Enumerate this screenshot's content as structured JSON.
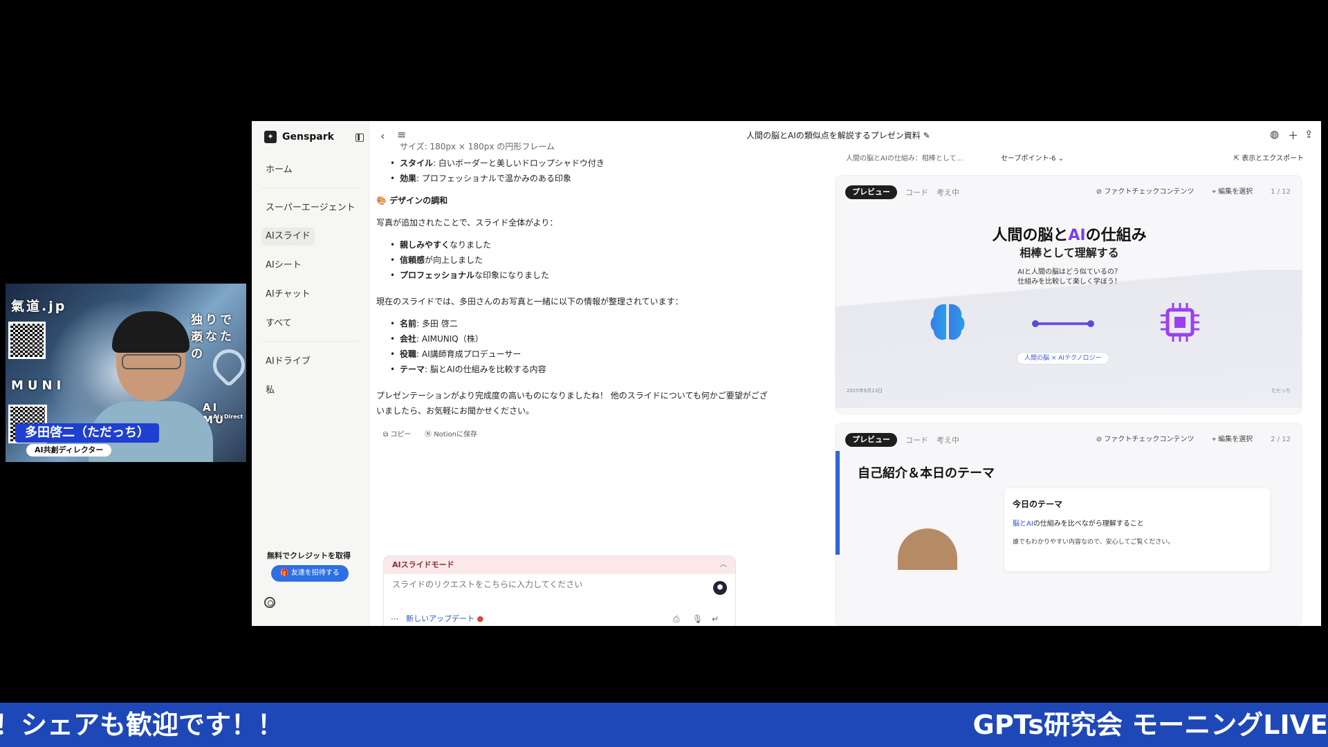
{
  "webcam": {
    "brand_top": "氣道.jp",
    "tagline_1": "独りで頑",
    "tagline_2": "あなたの",
    "brand_mid": "MUNI",
    "brand_right": "AI MU",
    "brand_right_sub": "AI×Direct",
    "name": "多田啓二（ただっち）",
    "role": "AI共創ディレクター"
  },
  "sidebar": {
    "brand": "Genspark",
    "items": [
      {
        "label": "ホーム"
      },
      {
        "label": "スーパーエージェント"
      },
      {
        "label": "AIスライド"
      },
      {
        "label": "AIシート"
      },
      {
        "label": "AIチャット"
      },
      {
        "label": "すべて"
      },
      {
        "label": "AIドライブ"
      },
      {
        "label": "私"
      }
    ],
    "credit_title": "無料でクレジットを取得",
    "invite_label": "友達を招待する"
  },
  "topbar": {
    "title": "人間の脳とAIの類似点を解説するプレゼン資料"
  },
  "chat": {
    "line_size": "サイズ: 180px × 180px の円形フレーム",
    "bullet_style_key": "スタイル",
    "bullet_style_val": ": 白いボーダーと美しいドロップシャドウ付き",
    "bullet_effect_key": "効果",
    "bullet_effect_val": ": プロフェッショナルで温かみのある印象",
    "section_heading": "🎨 デザインの調和",
    "intro": "写真が追加されたことで、スライド全体がより：",
    "b1_key": "親しみやすく",
    "b1_val": "なりました",
    "b2_key": "信頼感",
    "b2_val": "が向上しました",
    "b3_key": "プロフェッショナル",
    "b3_val": "な印象になりました",
    "summary": "現在のスライドでは、多田さんのお写真と一緒に以下の情報が整理されています：",
    "i1_key": "名前",
    "i1_val": ": 多田 啓二",
    "i2_key": "会社",
    "i2_val": ": AIMUNIQ（株）",
    "i3_key": "役職",
    "i3_val": ": AI講師育成プロデューサー",
    "i4_key": "テーマ",
    "i4_val": ": 脳とAIの仕組みを比較する内容",
    "closing_1": "プレゼンテーションがより完成度の高いものになりましたね！ 他のスライドについても何かご要望がござ",
    "closing_2": "いましたら、お気軽にお聞かせください。",
    "copy_label": "コピー",
    "notion_label": "Notionに保存"
  },
  "input": {
    "mode_label": "AIスライドモード",
    "placeholder": "スライドのリクエストをこちらに入力してください",
    "update_label": "新しいアップデート"
  },
  "preview": {
    "crumb": "人間の脳とAIの仕組み：相棒として…",
    "savepoint": "セーブポイント-6",
    "export": "表示とエクスポート",
    "tab_preview": "プレビュー",
    "tab_code": "コード",
    "tab_thinking": "考え中",
    "factcheck": "ファクトチェックコンテンツ",
    "edit_select": "編集を選択",
    "slide1": {
      "page": "1 / 12",
      "title_a": "人間の脳と",
      "title_ai": "AI",
      "title_b": "の仕組み",
      "subtitle": "相棒として理解する",
      "desc1": "AIと人間の脳はどう似ているの？",
      "desc2": "仕組みを比較して楽しく学ぼう！",
      "pill": "人間の脳 × AIテクノロジー",
      "date": "2025年6月13日",
      "author": "ただっち"
    },
    "slide2": {
      "page": "2 / 12",
      "title": "自己紹介＆本日のテーマ",
      "box_heading": "今日のテーマ",
      "box_hl": "脳とAI",
      "box_line1_rest": "の仕組みを比べながら理解すること",
      "box_line2": "誰でもわかりやすい内容なので、安心してご覧ください。"
    }
  },
  "ticker": {
    "left": "！シェアも歓迎です！！",
    "right": "GPTs研究会 モーニングLIVE"
  },
  "colors": {
    "ticker_bg": "#1e48b8",
    "accent_ai": "#7a3df0",
    "invite_btn": "#2f6fe4"
  }
}
